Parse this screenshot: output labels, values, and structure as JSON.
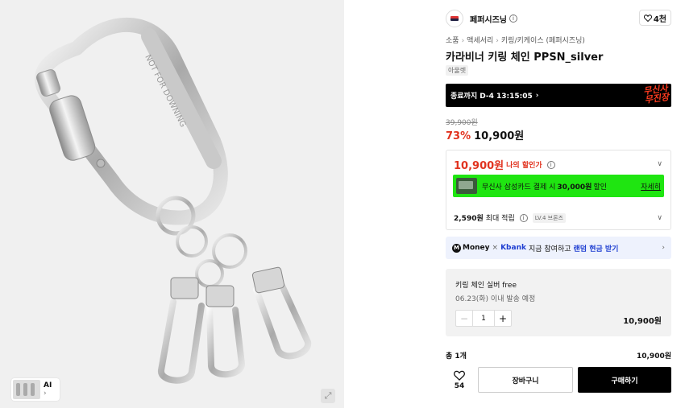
{
  "image": {
    "thumb_label": "AI",
    "thumb_chevron": "›",
    "engraving": "NOT FOR DOWNING",
    "zoom_icon": "expand-icon"
  },
  "brand": {
    "name": "페퍼시즈닝",
    "info_icon": "i",
    "likes": "4천"
  },
  "breadcrumb": [
    "소품",
    "액세서리",
    "키링/키케이스 (페퍼시즈닝)"
  ],
  "product": {
    "title": "카라비너 키링 체인 PPSN_silver",
    "tag": "아울렛"
  },
  "event": {
    "timer": "종료까지 D-4 13:15:05",
    "logo_line1": "무신사",
    "logo_line2": "무진장",
    "accent": "#ff3b1f"
  },
  "price": {
    "original": "39,900원",
    "discount": "73%",
    "current": "10,900원"
  },
  "benefit": {
    "my_price": "10,900원",
    "my_price_label": "나의 할인가",
    "card_text_pre": "무신사 삼성카드 결제 시",
    "card_text_amount": "30,000원",
    "card_text_post": "할인",
    "card_detail": "자세히",
    "reward_amount": "2,590원",
    "reward_label": "최대 적립",
    "level": "LV.4 브론즈",
    "green": "#1fe511",
    "red": "#e1331f"
  },
  "money_banner": {
    "brand": "Money",
    "bank": "Kbank",
    "text": "지금 참여하고",
    "highlight": "랜덤 현금 받기"
  },
  "option": {
    "name": "키링 체인 실버 free",
    "ship": "06.23(화) 이내 발송 예정",
    "qty": "1",
    "price": "10,900원"
  },
  "total": {
    "label": "총 1개",
    "price": "10,900원"
  },
  "actions": {
    "wish_count": "54",
    "cart": "장바구니",
    "buy": "구매하기"
  }
}
